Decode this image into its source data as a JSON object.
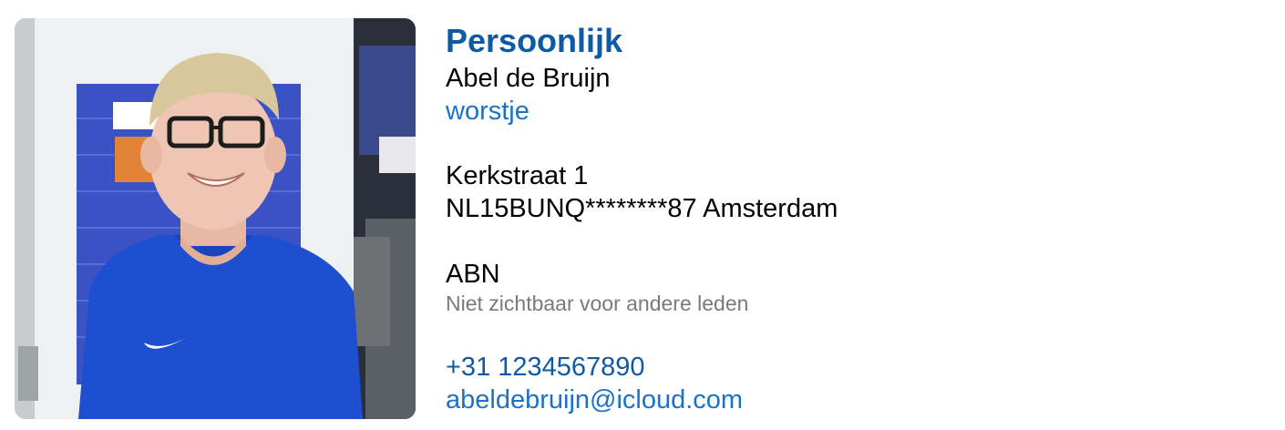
{
  "profile": {
    "photo_alt": "Profielfoto",
    "section_title": "Persoonlijk",
    "full_name": "Abel de Bruijn",
    "nickname": "worstje",
    "address_line": "Kerkstraat 1",
    "iban_city_line": "NL15BUNQ********87 Amsterdam",
    "bank_name": "ABN",
    "bank_visibility_note": "Niet zichtbaar voor andere leden",
    "phone": "+31 1234567890",
    "email": "abeldebruijn@icloud.com"
  },
  "colors": {
    "title_blue": "#0f5aa6",
    "link_blue": "#1a73c8",
    "muted_gray": "#7a7a7a",
    "shirt_blue": "#1f4fd1"
  }
}
